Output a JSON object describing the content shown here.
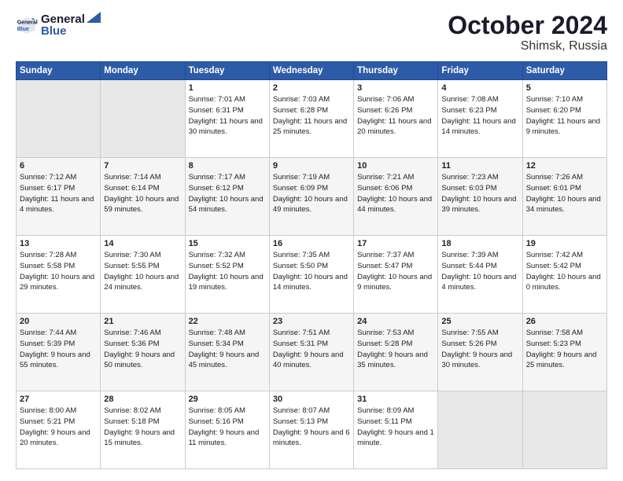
{
  "logo": {
    "line1": "General",
    "line2": "Blue"
  },
  "title": "October 2024",
  "location": "Shimsk, Russia",
  "days_header": [
    "Sunday",
    "Monday",
    "Tuesday",
    "Wednesday",
    "Thursday",
    "Friday",
    "Saturday"
  ],
  "weeks": [
    [
      {
        "num": "",
        "sunrise": "",
        "sunset": "",
        "daylight": ""
      },
      {
        "num": "",
        "sunrise": "",
        "sunset": "",
        "daylight": ""
      },
      {
        "num": "1",
        "sunrise": "Sunrise: 7:01 AM",
        "sunset": "Sunset: 6:31 PM",
        "daylight": "Daylight: 11 hours and 30 minutes."
      },
      {
        "num": "2",
        "sunrise": "Sunrise: 7:03 AM",
        "sunset": "Sunset: 6:28 PM",
        "daylight": "Daylight: 11 hours and 25 minutes."
      },
      {
        "num": "3",
        "sunrise": "Sunrise: 7:06 AM",
        "sunset": "Sunset: 6:26 PM",
        "daylight": "Daylight: 11 hours and 20 minutes."
      },
      {
        "num": "4",
        "sunrise": "Sunrise: 7:08 AM",
        "sunset": "Sunset: 6:23 PM",
        "daylight": "Daylight: 11 hours and 14 minutes."
      },
      {
        "num": "5",
        "sunrise": "Sunrise: 7:10 AM",
        "sunset": "Sunset: 6:20 PM",
        "daylight": "Daylight: 11 hours and 9 minutes."
      }
    ],
    [
      {
        "num": "6",
        "sunrise": "Sunrise: 7:12 AM",
        "sunset": "Sunset: 6:17 PM",
        "daylight": "Daylight: 11 hours and 4 minutes."
      },
      {
        "num": "7",
        "sunrise": "Sunrise: 7:14 AM",
        "sunset": "Sunset: 6:14 PM",
        "daylight": "Daylight: 10 hours and 59 minutes."
      },
      {
        "num": "8",
        "sunrise": "Sunrise: 7:17 AM",
        "sunset": "Sunset: 6:12 PM",
        "daylight": "Daylight: 10 hours and 54 minutes."
      },
      {
        "num": "9",
        "sunrise": "Sunrise: 7:19 AM",
        "sunset": "Sunset: 6:09 PM",
        "daylight": "Daylight: 10 hours and 49 minutes."
      },
      {
        "num": "10",
        "sunrise": "Sunrise: 7:21 AM",
        "sunset": "Sunset: 6:06 PM",
        "daylight": "Daylight: 10 hours and 44 minutes."
      },
      {
        "num": "11",
        "sunrise": "Sunrise: 7:23 AM",
        "sunset": "Sunset: 6:03 PM",
        "daylight": "Daylight: 10 hours and 39 minutes."
      },
      {
        "num": "12",
        "sunrise": "Sunrise: 7:26 AM",
        "sunset": "Sunset: 6:01 PM",
        "daylight": "Daylight: 10 hours and 34 minutes."
      }
    ],
    [
      {
        "num": "13",
        "sunrise": "Sunrise: 7:28 AM",
        "sunset": "Sunset: 5:58 PM",
        "daylight": "Daylight: 10 hours and 29 minutes."
      },
      {
        "num": "14",
        "sunrise": "Sunrise: 7:30 AM",
        "sunset": "Sunset: 5:55 PM",
        "daylight": "Daylight: 10 hours and 24 minutes."
      },
      {
        "num": "15",
        "sunrise": "Sunrise: 7:32 AM",
        "sunset": "Sunset: 5:52 PM",
        "daylight": "Daylight: 10 hours and 19 minutes."
      },
      {
        "num": "16",
        "sunrise": "Sunrise: 7:35 AM",
        "sunset": "Sunset: 5:50 PM",
        "daylight": "Daylight: 10 hours and 14 minutes."
      },
      {
        "num": "17",
        "sunrise": "Sunrise: 7:37 AM",
        "sunset": "Sunset: 5:47 PM",
        "daylight": "Daylight: 10 hours and 9 minutes."
      },
      {
        "num": "18",
        "sunrise": "Sunrise: 7:39 AM",
        "sunset": "Sunset: 5:44 PM",
        "daylight": "Daylight: 10 hours and 4 minutes."
      },
      {
        "num": "19",
        "sunrise": "Sunrise: 7:42 AM",
        "sunset": "Sunset: 5:42 PM",
        "daylight": "Daylight: 10 hours and 0 minutes."
      }
    ],
    [
      {
        "num": "20",
        "sunrise": "Sunrise: 7:44 AM",
        "sunset": "Sunset: 5:39 PM",
        "daylight": "Daylight: 9 hours and 55 minutes."
      },
      {
        "num": "21",
        "sunrise": "Sunrise: 7:46 AM",
        "sunset": "Sunset: 5:36 PM",
        "daylight": "Daylight: 9 hours and 50 minutes."
      },
      {
        "num": "22",
        "sunrise": "Sunrise: 7:48 AM",
        "sunset": "Sunset: 5:34 PM",
        "daylight": "Daylight: 9 hours and 45 minutes."
      },
      {
        "num": "23",
        "sunrise": "Sunrise: 7:51 AM",
        "sunset": "Sunset: 5:31 PM",
        "daylight": "Daylight: 9 hours and 40 minutes."
      },
      {
        "num": "24",
        "sunrise": "Sunrise: 7:53 AM",
        "sunset": "Sunset: 5:28 PM",
        "daylight": "Daylight: 9 hours and 35 minutes."
      },
      {
        "num": "25",
        "sunrise": "Sunrise: 7:55 AM",
        "sunset": "Sunset: 5:26 PM",
        "daylight": "Daylight: 9 hours and 30 minutes."
      },
      {
        "num": "26",
        "sunrise": "Sunrise: 7:58 AM",
        "sunset": "Sunset: 5:23 PM",
        "daylight": "Daylight: 9 hours and 25 minutes."
      }
    ],
    [
      {
        "num": "27",
        "sunrise": "Sunrise: 8:00 AM",
        "sunset": "Sunset: 5:21 PM",
        "daylight": "Daylight: 9 hours and 20 minutes."
      },
      {
        "num": "28",
        "sunrise": "Sunrise: 8:02 AM",
        "sunset": "Sunset: 5:18 PM",
        "daylight": "Daylight: 9 hours and 15 minutes."
      },
      {
        "num": "29",
        "sunrise": "Sunrise: 8:05 AM",
        "sunset": "Sunset: 5:16 PM",
        "daylight": "Daylight: 9 hours and 11 minutes."
      },
      {
        "num": "30",
        "sunrise": "Sunrise: 8:07 AM",
        "sunset": "Sunset: 5:13 PM",
        "daylight": "Daylight: 9 hours and 6 minutes."
      },
      {
        "num": "31",
        "sunrise": "Sunrise: 8:09 AM",
        "sunset": "Sunset: 5:11 PM",
        "daylight": "Daylight: 9 hours and 1 minute."
      },
      {
        "num": "",
        "sunrise": "",
        "sunset": "",
        "daylight": ""
      },
      {
        "num": "",
        "sunrise": "",
        "sunset": "",
        "daylight": ""
      }
    ]
  ]
}
